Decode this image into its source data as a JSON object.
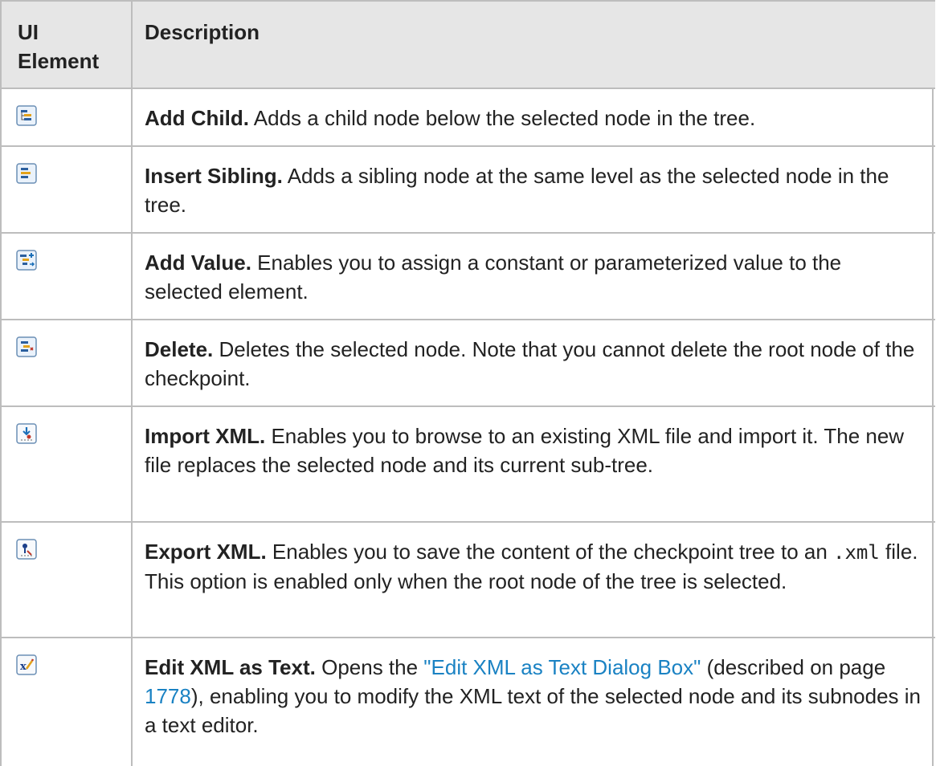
{
  "header": {
    "col1": "UI Element",
    "col2": "Description"
  },
  "rows": [
    {
      "icon": "add-child-icon",
      "title": "Add Child.",
      "text": " Adds a child node below the selected node in the tree."
    },
    {
      "icon": "insert-sibling-icon",
      "title": "Insert Sibling.",
      "text": " Adds a sibling node at the same level as the selected node in the tree."
    },
    {
      "icon": "add-value-icon",
      "title": "Add Value.",
      "text": " Enables you to assign a constant or parameterized value to the selected element."
    },
    {
      "icon": "delete-icon",
      "title": "Delete.",
      "text": " Deletes the selected node. Note that you cannot delete the root node of the checkpoint."
    },
    {
      "icon": "import-xml-icon",
      "title": "Import XML.",
      "text": " Enables you to browse to an existing XML file and import it. The new file replaces the selected node and its current sub-tree."
    },
    {
      "icon": "export-xml-icon",
      "title": "Export XML.",
      "text_a": " Enables you to save the content of the checkpoint tree to an ",
      "code": ".xml",
      "text_b": " file. This option is enabled only when the root node of the tree is selected."
    },
    {
      "icon": "edit-xml-as-text-icon",
      "title": "Edit XML as Text.",
      "text_a": " Opens the ",
      "link": "\"Edit XML as Text Dialog Box\"",
      "text_b": " (described on page ",
      "page_link": "1778",
      "text_c": "), enabling you to modify the XML text of the selected node and its subnodes in a text editor."
    }
  ]
}
